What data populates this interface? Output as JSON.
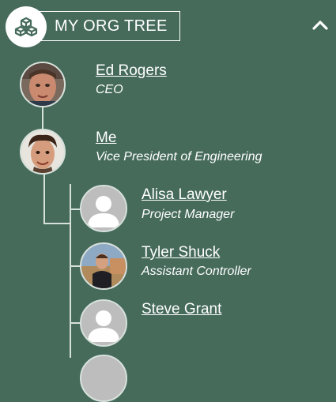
{
  "header": {
    "title": "MY ORG TREE",
    "icon": "boxes-icon",
    "collapse_icon": "chevron-up-icon"
  },
  "colors": {
    "background": "#466b5b",
    "connector": "#d7e1dc",
    "text": "#ffffff",
    "placeholder_avatar": "#bdbdbd"
  },
  "people": [
    {
      "name": "Ed Rogers",
      "title": "CEO",
      "avatar": "photo"
    },
    {
      "name": "Me",
      "title": "Vice President of Engineering",
      "avatar": "photo"
    },
    {
      "name": "Alisa Lawyer",
      "title": "Project Manager",
      "avatar": "placeholder"
    },
    {
      "name": "Tyler Shuck",
      "title": "Assistant Controller",
      "avatar": "photo"
    },
    {
      "name": "Steve Grant",
      "title": "",
      "avatar": "placeholder"
    }
  ]
}
